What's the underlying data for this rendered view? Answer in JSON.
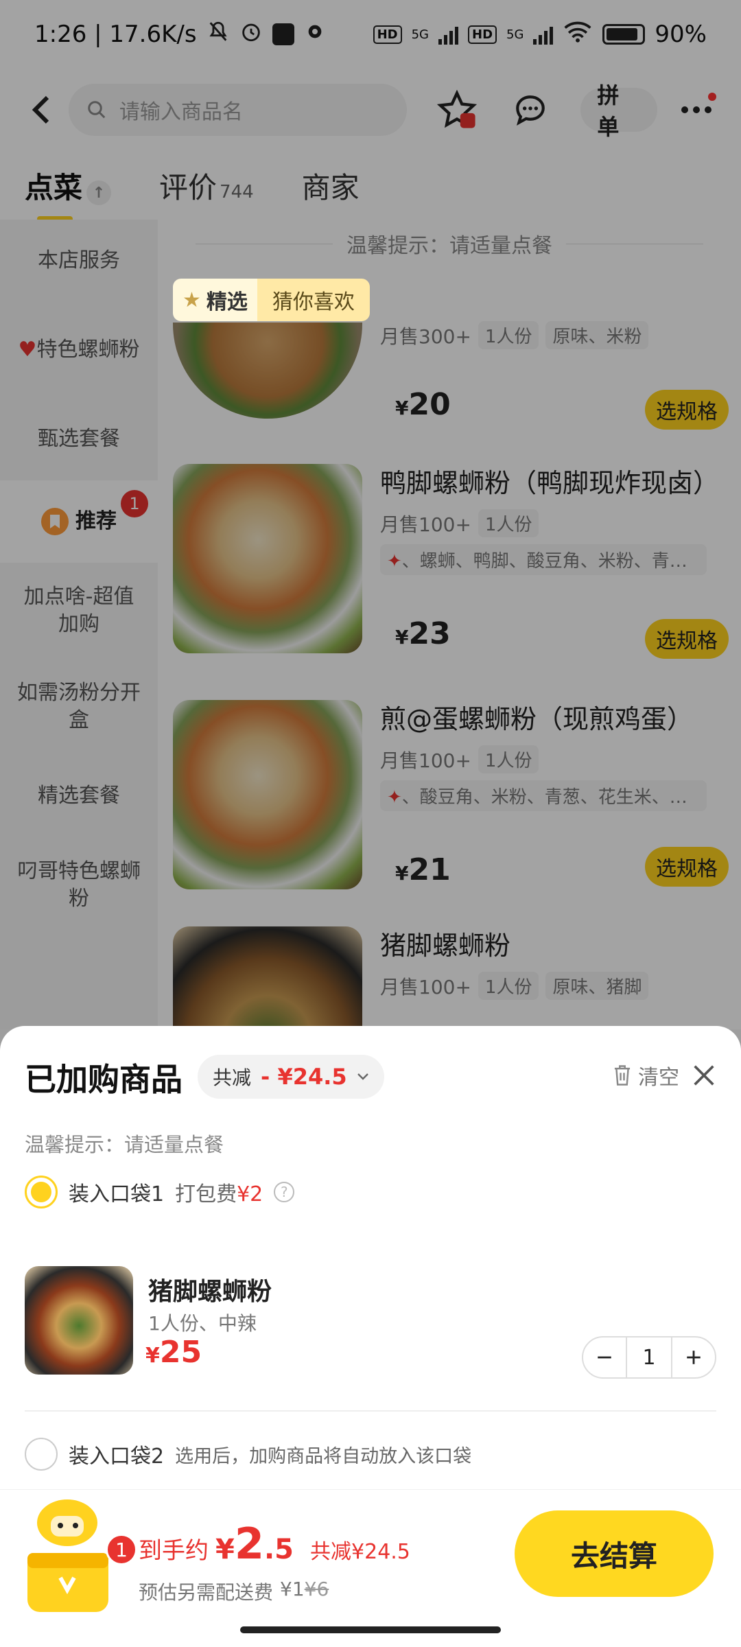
{
  "status_bar": {
    "time_speed": "1:26 | 17.6K/s",
    "net1": "5G",
    "net2": "5G",
    "hd": "HD",
    "battery": "90%",
    "battery_level": 0.9
  },
  "header": {
    "search_placeholder": "请输入商品名",
    "pindan_label": "拼单"
  },
  "tabs": [
    {
      "label": "点菜",
      "count": "",
      "active": true
    },
    {
      "label": "评价",
      "count": "744",
      "active": false
    },
    {
      "label": "商家",
      "count": "",
      "active": false
    }
  ],
  "sidebar": {
    "items": [
      {
        "label": "本店服务"
      },
      {
        "label": "特色螺蛳粉",
        "icon": "heart-icon"
      },
      {
        "label": "甄选套餐"
      },
      {
        "label": "推荐",
        "badge": "1",
        "active": true
      },
      {
        "label": "加点啥-超值加购"
      },
      {
        "label": "如需汤粉分开盒"
      },
      {
        "label": "精选套餐"
      },
      {
        "label": "叼哥特色螺蛳粉"
      }
    ]
  },
  "menu": {
    "tip": "温馨提示：请适量点餐",
    "chip_featured": "精选",
    "chip_guess": "猜你喜欢",
    "currency": "¥",
    "dishes": [
      {
        "name": "",
        "sales": "月售300+",
        "portion": "1人份",
        "taste": "原味、米粉",
        "price": "20",
        "button": "选规格"
      },
      {
        "name": "鸭脚螺蛳粉（鸭脚现炸现卤）",
        "sales": "月售100+",
        "portion": "1人份",
        "ingredients": "、螺蛳、鸭脚、酸豆角、米粉、青…",
        "price": "23",
        "button": "选规格"
      },
      {
        "name": "煎@蛋螺蛳粉（现煎鸡蛋）",
        "sales": "月售100+",
        "portion": "1人份",
        "ingredients": "、酸豆角、米粉、青葱、花生米、…",
        "price": "21",
        "button": "选规格"
      },
      {
        "name": "猪脚螺蛳粉",
        "sales": "月售100+",
        "portion": "1人份",
        "taste": "原味、猪脚"
      }
    ]
  },
  "cart": {
    "title": "已加购商品",
    "discount_label": "共减",
    "discount_value": "- ¥24.5",
    "clear_label": "清空",
    "tip": "温馨提示：请适量点餐",
    "bag1": {
      "label": "装入口袋1",
      "fee_label": "打包费",
      "fee_value": "¥2"
    },
    "item": {
      "name": "猪脚螺蛳粉",
      "spec": "1人份、中辣",
      "currency": "¥",
      "price": "25",
      "qty": "1"
    },
    "bag2": {
      "label": "装入口袋2",
      "note": "选用后，加购商品将自动放入该口袋"
    }
  },
  "checkout": {
    "badge": "1",
    "pay_label": "到手约",
    "pay_currency": "¥",
    "pay_int": "2",
    "pay_dec": ".5",
    "saved": "共减¥24.5",
    "fee_label": "预估另需配送费",
    "fee_value": "¥1",
    "fee_original": "¥6",
    "button": "去结算"
  },
  "colors": {
    "accent_yellow": "#ffd21f",
    "price_red": "#e8332f"
  }
}
